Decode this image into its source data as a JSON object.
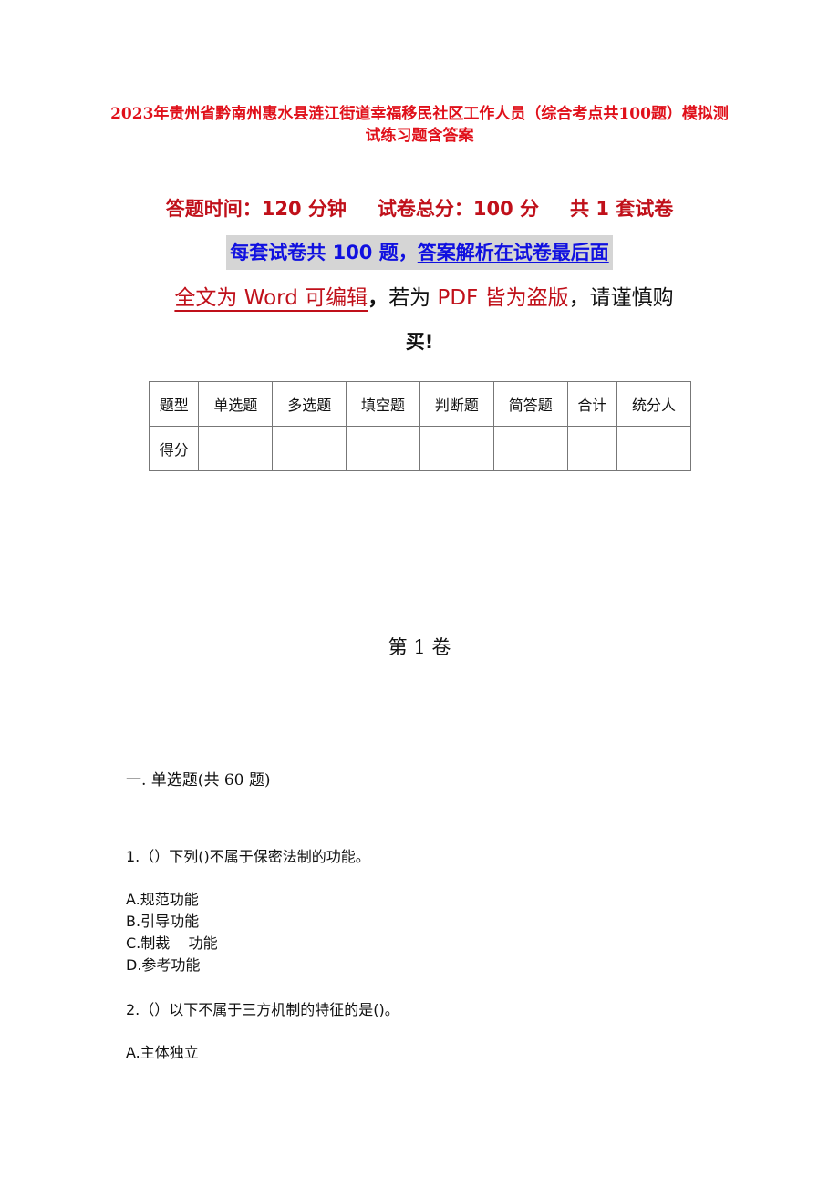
{
  "document": {
    "title": "2023年贵州省黔南州惠水县涟江街道幸福移民社区工作人员（综合考点共100题）模拟测试练习题含答案",
    "exam_info": {
      "time": "答题时间：120 分钟",
      "total_score": "试卷总分：100 分",
      "sets": "共 1 套试卷"
    },
    "notice": {
      "part1": "每套试卷共 100 题，",
      "part2": "答案解析在试卷最后面"
    },
    "warning": {
      "editable": "全文为 Word 可编辑",
      "comma1": "，",
      "if_pdf": "若为 ",
      "pirated": "PDF 皆为盗版",
      "caution": "，请谨慎购",
      "line2": "买!"
    },
    "score_table": {
      "header": [
        "题型",
        "单选题",
        "多选题",
        "填空题",
        "判断题",
        "简答题",
        "合计",
        "统分人"
      ],
      "row": [
        "得分",
        "",
        "",
        "",
        "",
        "",
        "",
        ""
      ]
    },
    "volume_label": "第 1 卷",
    "section": {
      "heading": "一. 单选题(共 60 题)"
    },
    "questions": [
      {
        "text": "1.（）下列()不属于保密法制的功能。",
        "options": [
          "A.规范功能",
          "B.引导功能",
          "C.制裁    功能",
          "D.参考功能"
        ]
      },
      {
        "text": "2.（）以下不属于三方机制的特征的是()。",
        "options": [
          "A.主体独立"
        ]
      }
    ]
  },
  "colors": {
    "title_red": "#e0101a",
    "info_red": "#c0101a",
    "notice_blue": "#1010e0",
    "notice_bg": "#d5d5d5"
  }
}
